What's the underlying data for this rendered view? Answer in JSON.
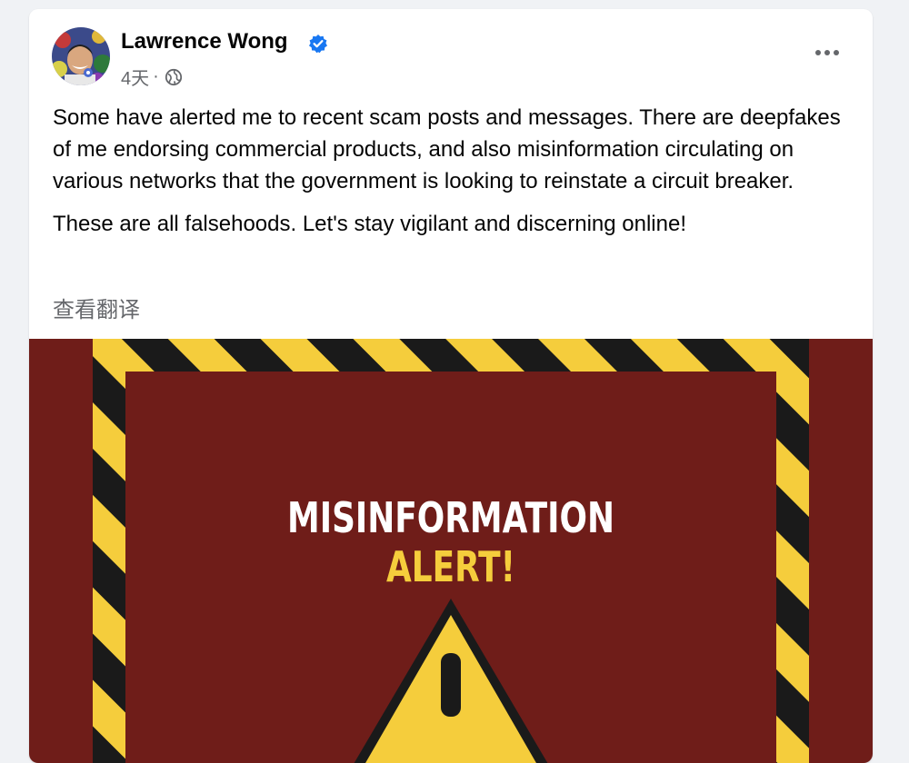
{
  "post": {
    "author": "Lawrence Wong",
    "verified_icon": "verified-badge-icon",
    "timestamp": "4天",
    "separator": "·",
    "audience_icon": "globe-icon",
    "more_icon": "more-options-icon",
    "paragraphs": [
      "Some have alerted me to recent scam posts and messages. There are deepfakes of me endorsing commercial products, and also misinformation circulating on various networks that the government is looking to reinstate a circuit breaker.",
      "These are all falsehoods. Let's stay vigilant and discerning online!"
    ],
    "translate_link": "查看翻译"
  },
  "image": {
    "line1": "MISINFORMATION",
    "line2": "ALERT!",
    "colors": {
      "background": "#6f1d19",
      "stripe_yellow": "#f5cd3c",
      "stripe_black": "#1a1a1a",
      "title_white": "#ffffff",
      "title_yellow": "#f5cd3c",
      "warning_fill": "#f5cd3c"
    }
  },
  "colors": {
    "page_bg": "#f0f2f5",
    "card_bg": "#ffffff",
    "primary_text": "#050505",
    "secondary_text": "#65676b",
    "verified_blue": "#1877f2"
  }
}
